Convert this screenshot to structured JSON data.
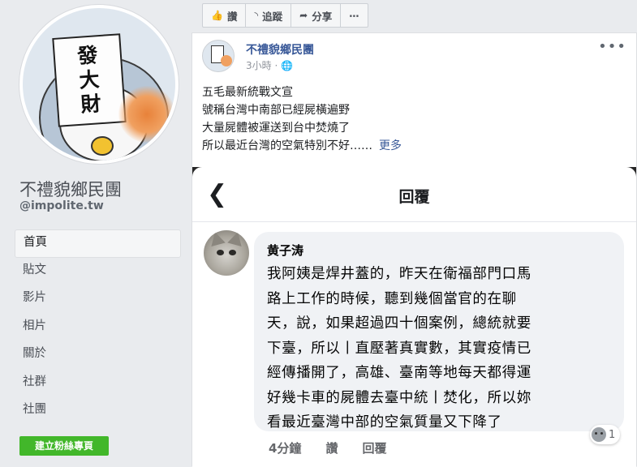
{
  "sidebar": {
    "avatar_sign_chars": [
      "發",
      "大",
      "財"
    ],
    "page_name": "不禮貌鄉民團",
    "handle": "@impolite.tw",
    "nav": [
      "首頁",
      "貼文",
      "影片",
      "相片",
      "關於",
      "社群",
      "社團"
    ],
    "create_button": "建立粉絲專頁"
  },
  "actions": {
    "like": "讚",
    "follow": "追蹤",
    "share": "分享",
    "more": "⋯"
  },
  "post": {
    "author": "不禮貌鄉民團",
    "time": "3小時",
    "text_lines": [
      "五毛最新統戰文宣",
      "號稱台灣中南部已經屍橫遍野",
      "大量屍體被運送到台中焚燒了",
      "所以最近台灣的空氣特別不好……"
    ],
    "see_more": "更多",
    "screenshot": {
      "title": "回覆",
      "commenter": "黄子涛",
      "comment_lines": [
        "我阿姨是焊井蓋的，昨天在衛福部門口馬",
        "路上工作的時候，聽到幾個當官的在聊",
        "天，說，如果超過四十個案例，總統就要",
        "下臺，所以丨直壓著真實數，其實疫情已",
        "經傳播開了，高雄、臺南等地每天都得運",
        "好幾卡車的屍體去臺中統丨焚化，所以妳",
        "看最近臺灣中部的空氣質量又下降了"
      ],
      "comment_time": "4分鐘",
      "comment_like": "讚",
      "comment_reply": "回覆",
      "reaction_count": "1"
    }
  },
  "colors": {
    "link": "#385898",
    "green_button": "#42b72a"
  }
}
